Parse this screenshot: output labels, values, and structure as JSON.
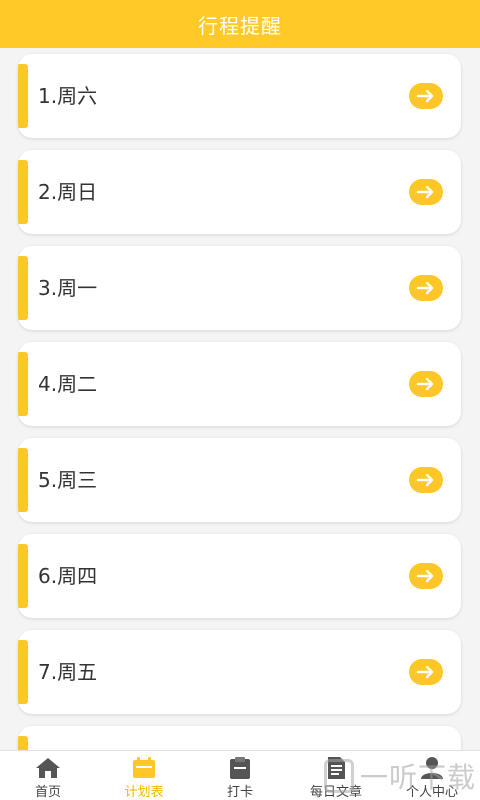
{
  "header": {
    "title": "行程提醒"
  },
  "items": [
    {
      "label": "1.周六"
    },
    {
      "label": "2.周日"
    },
    {
      "label": "3.周一"
    },
    {
      "label": "4.周二"
    },
    {
      "label": "5.周三"
    },
    {
      "label": "6.周四"
    },
    {
      "label": "7.周五"
    }
  ],
  "tabbar": {
    "tabs": [
      {
        "label": "首页",
        "icon": "home-icon"
      },
      {
        "label": "计划表",
        "icon": "calendar-icon",
        "active": true
      },
      {
        "label": "打卡",
        "icon": "clipboard-icon"
      },
      {
        "label": "每日文章",
        "icon": "document-icon"
      },
      {
        "label": "个人中心",
        "icon": "user-icon"
      }
    ]
  },
  "watermark": {
    "text": "一听下载"
  },
  "colors": {
    "accent": "#ffc927",
    "background": "#f4f4f4",
    "text": "#333333"
  }
}
